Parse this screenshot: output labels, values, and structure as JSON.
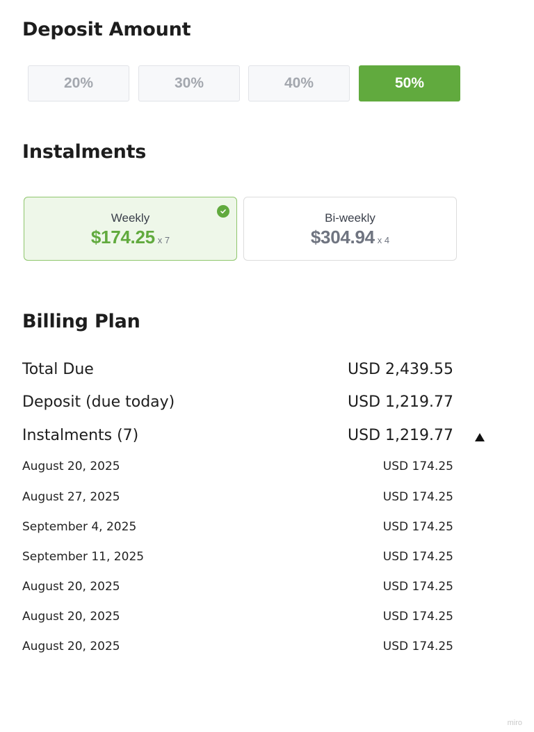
{
  "deposit": {
    "title": "Deposit Amount",
    "options": [
      {
        "label": "20%",
        "selected": false
      },
      {
        "label": "30%",
        "selected": false
      },
      {
        "label": "40%",
        "selected": false
      },
      {
        "label": "50%",
        "selected": true
      }
    ]
  },
  "instalments": {
    "title": "Instalments",
    "cards": [
      {
        "label": "Weekly",
        "amount": "$174.25",
        "count": "x 7",
        "selected": true
      },
      {
        "label": "Bi-weekly",
        "amount": "$304.94",
        "count": "x 4",
        "selected": false
      }
    ]
  },
  "billing": {
    "title": "Billing Plan",
    "total_due": {
      "label": "Total Due",
      "value": "USD 2,439.55"
    },
    "deposit_due": {
      "label": "Deposit (due today)",
      "value": "USD 1,219.77"
    },
    "instalments_row": {
      "label": "Instalments (7)",
      "value": "USD 1,219.77",
      "expanded": true,
      "toggle_icon": "triangle-up-icon"
    },
    "schedule": [
      {
        "date": "August 20, 2025",
        "amount": "USD 174.25"
      },
      {
        "date": "August 27, 2025",
        "amount": "USD 174.25"
      },
      {
        "date": "September 4, 2025",
        "amount": "USD 174.25"
      },
      {
        "date": "September 11, 2025",
        "amount": "USD 174.25"
      },
      {
        "date": "August 20, 2025",
        "amount": "USD 174.25"
      },
      {
        "date": "August 20, 2025",
        "amount": "USD 174.25"
      },
      {
        "date": "August 20, 2025",
        "amount": "USD 174.25"
      }
    ]
  },
  "watermark": "miro",
  "colors": {
    "accent": "#61aa3e",
    "selected_card_bg": "#eef7e9",
    "muted_text": "#a3a7ae"
  }
}
